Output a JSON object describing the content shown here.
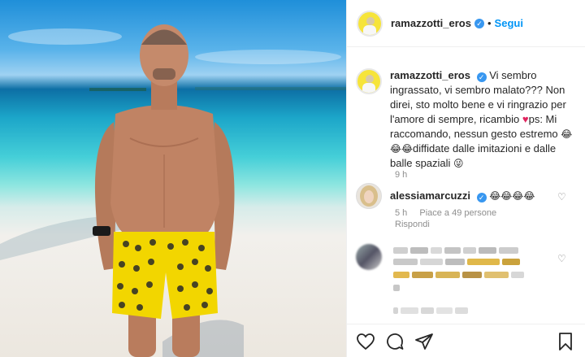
{
  "post": {
    "username": "ramazzotti_eros",
    "follow_label": "Segui",
    "dot": "•",
    "caption_user": "ramazzotti_eros",
    "caption_parts": {
      "p1": "Vi sembro ingrassato, vi sembro malato??? Non direi, sto molto bene e vi ringrazio per l'amore di sempre, ricambio ",
      "p2": "ps: Mi raccomando, nessun gesto estremo ",
      "p3": "diffidate dalle imitazioni e dalle balle spaziali "
    },
    "emojis": {
      "heart": "♥",
      "laugh3": "😂😂😂",
      "wink": "😜",
      "laugh4": "😂😂😂😂"
    },
    "caption_time": "9 h"
  },
  "comment": {
    "username": "alessiamarcuzzi",
    "time": "5 h",
    "likes": "Piace a 49 persone",
    "reply_label": "Rispondi"
  },
  "icons": {
    "heart": "heart-icon",
    "comment": "comment-icon",
    "share": "share-icon",
    "bookmark": "bookmark-icon",
    "verified": "verified-badge-icon"
  },
  "colors": {
    "accent": "#0095f6",
    "verified": "#3897f0",
    "shorts_yellow": "#f2d600"
  }
}
